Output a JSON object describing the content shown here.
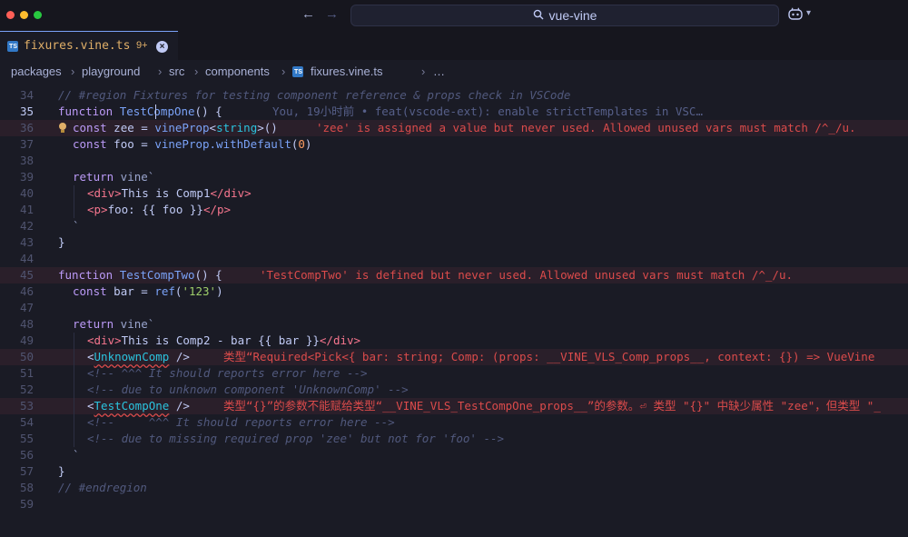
{
  "window": {
    "search_text": "vue-vine",
    "search_icon": "magnifier-icon",
    "copilot_icon": "copilot-icon",
    "traffic_light_colors": [
      "#ff5f57",
      "#febc2e",
      "#28c840"
    ]
  },
  "tab": {
    "title": "fixures.vine.ts",
    "problem_count": "9+",
    "close_symbol": "×",
    "badge": "TS"
  },
  "breadcrumb": {
    "items": [
      "packages",
      "playground",
      "src",
      "components"
    ],
    "file": "fixures.vine.ts",
    "trail": "…",
    "separator": "›"
  },
  "editor": {
    "lines": {
      "l34": "// #region Fixtures for testing component reference & props check in VSCode",
      "l35_kw": "function",
      "l35_fn_a": "TestC",
      "l35_fn_b": "ompOne",
      "l35_rest": "() {",
      "l35_blame": "You, 19小时前 • feat(vscode-ext): enable strictTemplates in VSC…",
      "l36_kw": "const",
      "l36_var": "zee",
      "l36_eq": " = ",
      "l36_call": "vineProp",
      "l36_lt": "<",
      "l36_type": "string",
      "l36_gt": ">()",
      "l36_diag": "'zee' is assigned a value but never used. Allowed unused vars must match /^_/u.",
      "l37_kw": "const",
      "l37_rest1": " foo = ",
      "l37_call": "vineProp.withDefault",
      "l37_p1": "(",
      "l37_num": "0",
      "l37_p2": ")",
      "l39_kw": "return",
      "l39_rest": " vine`",
      "l40_open": "<div>",
      "l40_text": "This is Comp1",
      "l40_close": "</div>",
      "l41_open": "<p>",
      "l41_text": "foo: {{ foo }}",
      "l41_close": "</p>",
      "l42": "`",
      "l43": "}",
      "l45_kw": "function",
      "l45_fn": "TestCompTwo",
      "l45_rest": "() {",
      "l45_diag": "'TestCompTwo' is defined but never used. Allowed unused vars must match /^_/u.",
      "l46_kw": "const",
      "l46_rest": " bar = ",
      "l46_call": "ref",
      "l46_p1": "(",
      "l46_str": "'123'",
      "l46_p2": ")",
      "l48_kw": "return",
      "l48_rest": " vine`",
      "l49_open": "<div>",
      "l49_text": "This is Comp2 - bar {{ bar }}",
      "l49_close": "</div>",
      "l50_lt": "<",
      "l50_tag": "UnknownComp",
      "l50_end": " />",
      "l50_diag": "类型“Required<Pick<{ bar: string; Comp: (props: __VINE_VLS_Comp_props__, context: {}) => VueVine",
      "l51": "<!-- ^^^ It should reports error here -->",
      "l52": "<!-- due to unknown component 'UnknownComp' -->",
      "l53_lt": "<",
      "l53_tag": "TestCompOne",
      "l53_end": " />",
      "l53_diag": "类型“{}”的参数不能赋给类型“__VINE_VLS_TestCompOne_props__”的参数。⏎ 类型 \"{}\" 中缺少属性 \"zee\"，但类型 \"_",
      "l54": "<!--     ^^^ It should reports error here -->",
      "l55": "<!-- due to missing required prop 'zee' but not for 'foo' -->",
      "l56": "`",
      "l57": "}",
      "l58": "// #endregion"
    },
    "line_numbers": [
      "34",
      "35",
      "36",
      "37",
      "38",
      "39",
      "40",
      "41",
      "42",
      "43",
      "44",
      "45",
      "46",
      "47",
      "48",
      "49",
      "50",
      "51",
      "52",
      "53",
      "54",
      "55",
      "56",
      "57",
      "58",
      "59"
    ],
    "active_line": "35"
  }
}
